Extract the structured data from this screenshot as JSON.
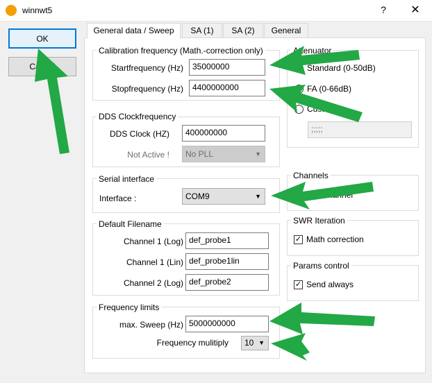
{
  "window": {
    "title": "winnwt5",
    "help": "?",
    "close": "✕"
  },
  "buttons": {
    "ok": "OK",
    "cancel": "Cancel"
  },
  "tabs": [
    {
      "label": "General data / Sweep"
    },
    {
      "label": "SA (1)"
    },
    {
      "label": "SA (2)"
    },
    {
      "label": "General"
    }
  ],
  "calibration": {
    "title": "Calibration frequency (Math.-correction only)",
    "start_label": "Startfrequency (Hz)",
    "start_value": "35000000",
    "stop_label": "Stopfrequency (Hz)",
    "stop_value": "4400000000"
  },
  "dds": {
    "title": "DDS Clockfrequency",
    "clock_label": "DDS Clock (HZ)",
    "clock_value": "400000000",
    "pll_label": "Not Active !",
    "pll_value": "No PLL"
  },
  "serial": {
    "title": "Serial interface",
    "interface_label": "Interface :",
    "interface_value": "COM9"
  },
  "filenames": {
    "title": "Default Filename",
    "ch1log_label": "Channel 1 (Log)",
    "ch1log_value": "def_probe1",
    "ch1lin_label": "Channel 1 (Lin)",
    "ch1lin_value": "def_probe1lin",
    "ch2log_label": "Channel 2 (Log)",
    "ch2log_value": "def_probe2"
  },
  "freq_limits": {
    "title": "Frequency limits",
    "max_label": "max. Sweep (Hz)",
    "max_value": "5000000000",
    "mult_label": "Frequency mulitiply",
    "mult_value": "10"
  },
  "attenuator": {
    "title": "Attenuator",
    "standard": "Standard (0-50dB)",
    "fa": "FA (0-66dB)",
    "custom": "Custom",
    "custom_value": ";;;;;"
  },
  "channels": {
    "title": "Channels",
    "option": "One channel"
  },
  "swr": {
    "title": "SWR Iteration",
    "math": "Math correction",
    "math_checked": true
  },
  "params": {
    "title": "Params control",
    "send": "Send always",
    "send_checked": true
  },
  "colors": {
    "arrow": "#22a845",
    "accent": "#0078d7"
  }
}
